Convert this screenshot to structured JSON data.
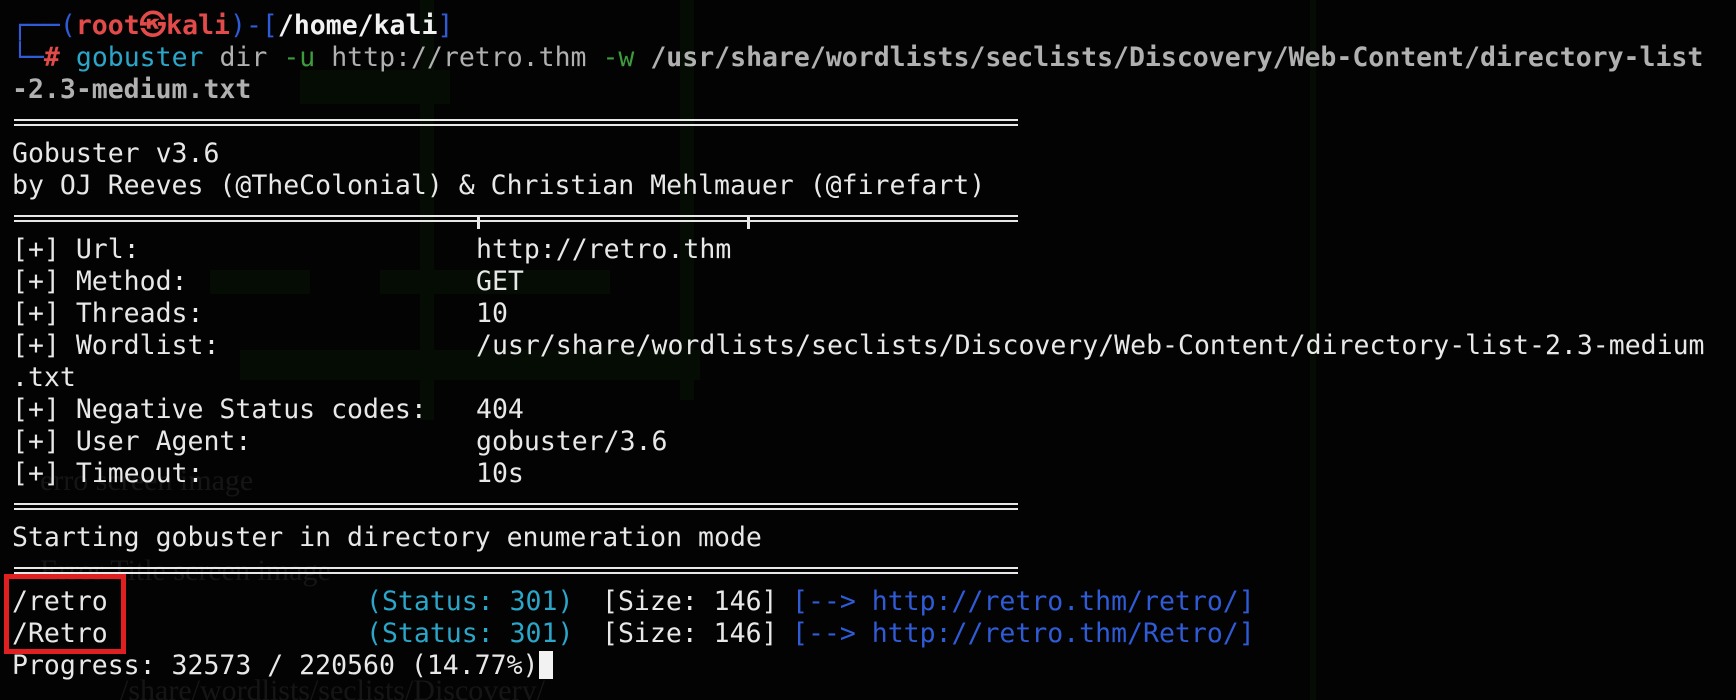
{
  "prompt": {
    "corner_top": "┌──",
    "paren_open": "(",
    "user": "root",
    "separator": "㉿",
    "host": "kali",
    "paren_close": ")-[",
    "cwd": "/home/kali",
    "bracket_close": "]",
    "corner_bottom": "└─",
    "hash": "#",
    "cmd": "gobuster",
    "arg1": "dir",
    "flag_u": "-u",
    "url": "http://retro.thm",
    "flag_w": "-w",
    "wordlist_part1": "/usr/share/wordlists/seclists/Discovery/Web-Content/directory-list",
    "wordlist_part2": "-2.3-medium.txt"
  },
  "banner": {
    "version": "Gobuster v3.6",
    "authors": "by OJ Reeves (@TheColonial) & Christian Mehlmauer (@firefart)"
  },
  "config": [
    {
      "label": "[+] Url:",
      "value": "http://retro.thm"
    },
    {
      "label": "[+] Method:",
      "value": "GET"
    },
    {
      "label": "[+] Threads:",
      "value": "10"
    },
    {
      "label": "[+] Wordlist:",
      "value": "/usr/share/wordlists/seclists/Discovery/Web-Content/directory-list-2.3-medium",
      "wrap": ".txt"
    },
    {
      "label": "[+] Negative Status codes:",
      "value": "404"
    },
    {
      "label": "[+] User Agent:",
      "value": "gobuster/3.6"
    },
    {
      "label": "[+] Timeout:",
      "value": "10s"
    }
  ],
  "status_msg": "Starting gobuster in directory enumeration mode",
  "results": [
    {
      "path": "/retro",
      "status": "(Status: 301)",
      "size": "[Size: 146]",
      "redirect": "[--> http://retro.thm/retro/]"
    },
    {
      "path": "/Retro",
      "status": "(Status: 301)",
      "size": "[Size: 146]",
      "redirect": "[--> http://retro.thm/Retro/]"
    }
  ],
  "progress": "Progress: 32573 / 220560 (14.77%)",
  "colors": {
    "background": "#030303",
    "prompt_blue": "#2f5bd6",
    "prompt_red": "#e34a4a",
    "status_cyan": "#2ba6c9",
    "highlight_red": "#e02020"
  }
}
